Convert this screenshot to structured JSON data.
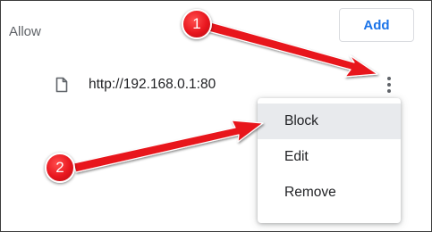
{
  "section": {
    "label": "Allow",
    "add_label": "Add"
  },
  "site": {
    "url": "http://192.168.0.1:80",
    "icon": "file-icon",
    "more_icon": "more-vert-icon"
  },
  "menu": {
    "items": [
      {
        "label": "Block",
        "highlighted": true
      },
      {
        "label": "Edit",
        "highlighted": false
      },
      {
        "label": "Remove",
        "highlighted": false
      }
    ]
  },
  "callouts": [
    {
      "number": "1"
    },
    {
      "number": "2"
    }
  ],
  "colors": {
    "accent": "#1a73e8",
    "annotation_red": "#e8161e",
    "menu_highlight": "#e8eaed"
  }
}
